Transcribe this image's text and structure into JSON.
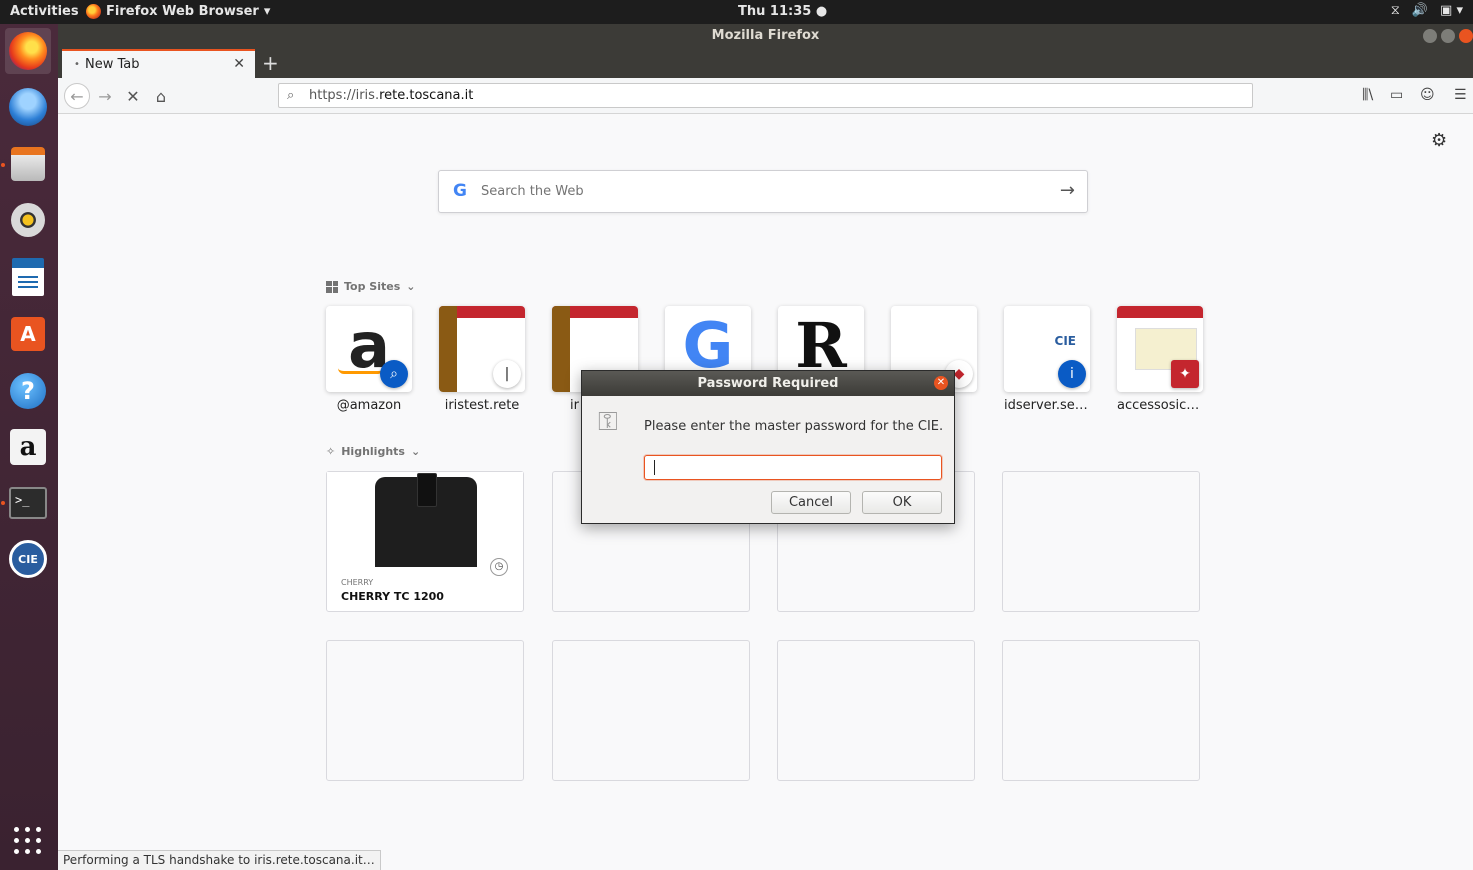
{
  "topbar": {
    "activities": "Activities",
    "app_name": "Firefox Web Browser",
    "clock": "Thu 11:35"
  },
  "window": {
    "title": "Mozilla Firefox"
  },
  "tab": {
    "title": "New Tab"
  },
  "urlbar": {
    "scheme": "https://iris.",
    "host": "rete.toscana.it"
  },
  "search": {
    "placeholder": "Search the Web"
  },
  "top_sites": {
    "title": "Top Sites",
    "items": [
      {
        "label": "@amazon"
      },
      {
        "label": "iristest.rete"
      },
      {
        "label": "ir"
      },
      {
        "label": ""
      },
      {
        "label": ""
      },
      {
        "label": ""
      },
      {
        "label": "idserver.ser…"
      },
      {
        "label": "accessosicu…"
      }
    ]
  },
  "highlights": {
    "title": "Highlights",
    "card": {
      "source": "CHERRY",
      "title": "CHERRY TC 1200"
    }
  },
  "dialog": {
    "title": "Password Required",
    "message": "Please enter the master password for the CIE.",
    "password_value": "",
    "cancel": "Cancel",
    "ok": "OK"
  },
  "status": {
    "text": "Performing a TLS handshake to iris.rete.toscana.it…"
  },
  "colors": {
    "accent": "#e95420",
    "dock_bg": "#3c2431",
    "titlebar": "#3c3b37"
  }
}
